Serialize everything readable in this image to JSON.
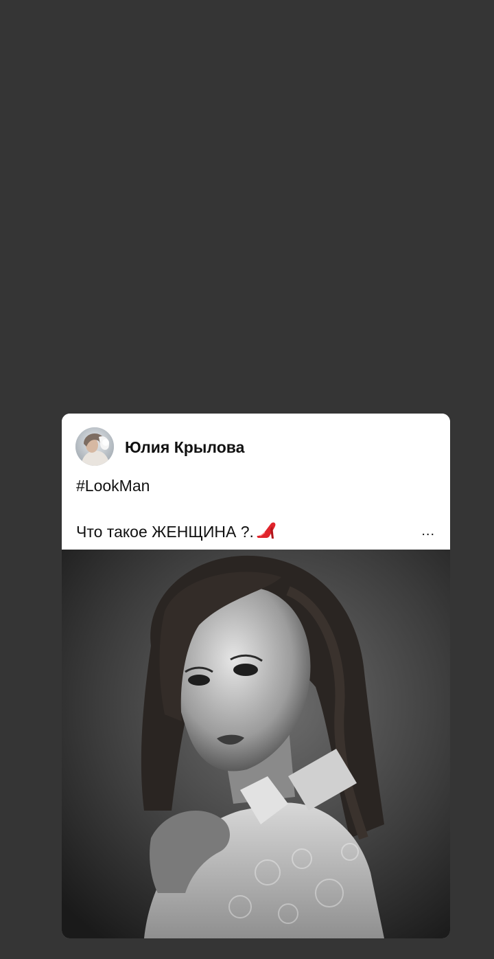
{
  "post": {
    "author_name": "Юлия Крылова",
    "hashtag": "#LookMan",
    "text": "Что такое ЖЕНЩИНА ?.",
    "emoji_icon": "high-heel-shoe-icon",
    "more_label": "..."
  },
  "colors": {
    "background": "#353535",
    "card": "#ffffff",
    "text": "#111111"
  }
}
